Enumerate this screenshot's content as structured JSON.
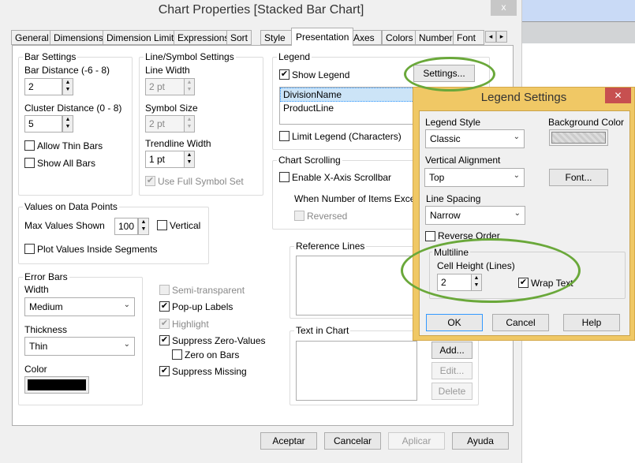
{
  "window": {
    "title": "Chart Properties [Stacked Bar Chart]",
    "close": "x"
  },
  "tabs": [
    "General",
    "Dimensions",
    "Dimension Limits",
    "Expressions",
    "Sort",
    "Style",
    "Presentation",
    "Axes",
    "Colors",
    "Number",
    "Font"
  ],
  "tab_scroll": {
    "left": "◂",
    "right": "▸"
  },
  "bar_settings": {
    "label": "Bar Settings",
    "bar_distance_label": "Bar Distance (-6 - 8)",
    "bar_distance": "2",
    "cluster_label": "Cluster Distance (0 - 8)",
    "cluster": "5",
    "allow_thin": "Allow Thin Bars",
    "show_all": "Show All Bars"
  },
  "line_settings": {
    "label": "Line/Symbol Settings",
    "line_width_label": "Line Width",
    "line_width": "2 pt",
    "symbol_size_label": "Symbol Size",
    "symbol_size": "2 pt",
    "trend_label": "Trendline Width",
    "trend": "1 pt",
    "full_symbol": "Use Full Symbol Set"
  },
  "values": {
    "label": "Values on Data Points",
    "max_label": "Max Values Shown",
    "max": "100",
    "vertical": "Vertical",
    "inside": "Plot Values Inside Segments"
  },
  "error_bars": {
    "label": "Error Bars",
    "width_label": "Width",
    "width": "Medium",
    "thickness_label": "Thickness",
    "thickness": "Thin",
    "color_label": "Color",
    "color": "#000000"
  },
  "options": {
    "semi": "Semi-transparent",
    "popup": "Pop-up Labels",
    "highlight": "Highlight",
    "suppress_zero": "Suppress Zero-Values",
    "zero_bars": "Zero on Bars",
    "suppress_missing": "Suppress Missing"
  },
  "legend": {
    "label": "Legend",
    "show": "Show Legend",
    "settings": "Settings...",
    "items": [
      "DivisionName",
      "ProductLine"
    ],
    "limit": "Limit Legend (Characters)"
  },
  "scrolling": {
    "label": "Chart Scrolling",
    "enable": "Enable X-Axis Scrollbar",
    "when": "When Number of Items Exceeds",
    "reversed": "Reversed"
  },
  "reference_lines": {
    "label": "Reference Lines"
  },
  "text_in_chart": {
    "label": "Text in Chart",
    "add": "Add...",
    "edit": "Edit...",
    "delete": "Delete"
  },
  "footer": {
    "accept": "Aceptar",
    "cancel": "Cancelar",
    "apply": "Aplicar",
    "help": "Ayuda"
  },
  "legend_dialog": {
    "title": "Legend Settings",
    "close": "✕",
    "style_label": "Legend Style",
    "style": "Classic",
    "bg_label": "Background Color",
    "valign_label": "Vertical Alignment",
    "valign": "Top",
    "font": "Font...",
    "spacing_label": "Line Spacing",
    "spacing": "Narrow",
    "reverse": "Reverse Order",
    "multiline": "Multiline",
    "cell_label": "Cell Height (Lines)",
    "cell": "2",
    "wrap": "Wrap Text",
    "ok": "OK",
    "cancel": "Cancel",
    "help": "Help"
  },
  "colors": {
    "highlight_oval": "#6aa83a",
    "dialog_frame": "#f0c865",
    "close_red": "#c75050",
    "selection": "#3399ff"
  }
}
